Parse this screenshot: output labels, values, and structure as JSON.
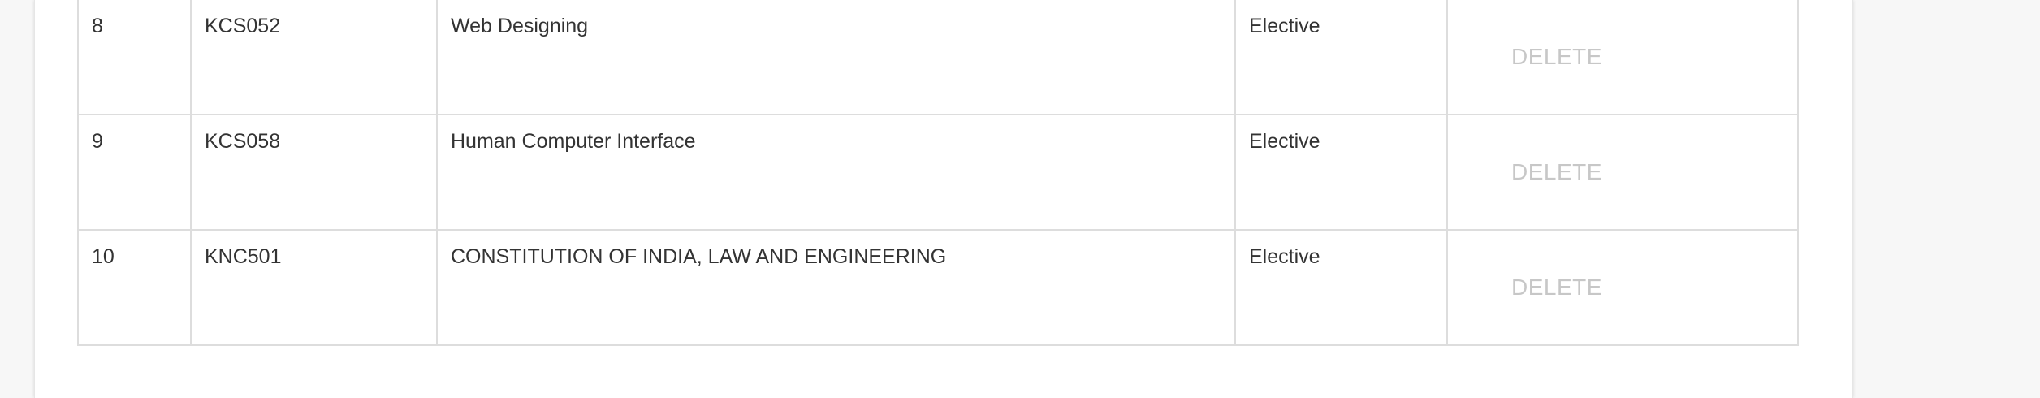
{
  "table": {
    "rows": [
      {
        "num": "8",
        "code": "KCS052",
        "name": "Web Designing",
        "type": "Elective",
        "action": "DELETE"
      },
      {
        "num": "9",
        "code": "KCS058",
        "name": "Human Computer Interface",
        "type": "Elective",
        "action": "DELETE"
      },
      {
        "num": "10",
        "code": "KNC501",
        "name": "CONSTITUTION OF INDIA, LAW AND ENGINEERING",
        "type": "Elective",
        "action": "DELETE"
      }
    ]
  }
}
